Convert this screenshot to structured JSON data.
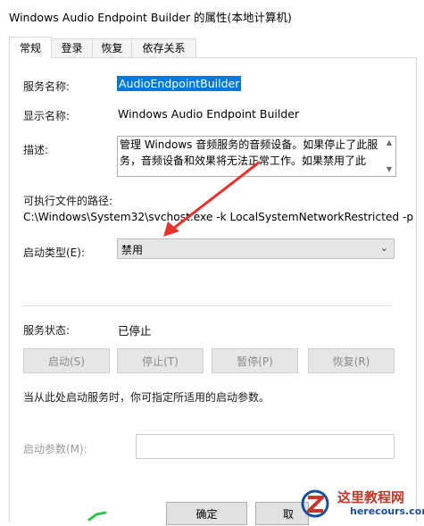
{
  "window": {
    "title": "Windows Audio Endpoint Builder 的属性(本地计算机)"
  },
  "tabs": [
    {
      "label": "常规",
      "active": true
    },
    {
      "label": "登录",
      "active": false
    },
    {
      "label": "恢复",
      "active": false
    },
    {
      "label": "依存关系",
      "active": false
    }
  ],
  "general": {
    "service_name_label": "服务名称:",
    "service_name_value": "AudioEndpointBuilder",
    "display_name_label": "显示名称:",
    "display_name_value": "Windows Audio Endpoint Builder",
    "description_label": "描述:",
    "description_value": "管理 Windows 音频服务的音频设备。如果停止了此服务，音频设备和效果将无法正常工作。如果禁用了此",
    "exe_path_label": "可执行文件的路径:",
    "exe_path_value": "C:\\Windows\\System32\\svchost.exe -k LocalSystemNetworkRestricted -p",
    "startup_type_label": "启动类型(E):",
    "startup_type_value": "禁用",
    "service_status_label": "服务状态:",
    "service_status_value": "已停止",
    "buttons": {
      "start": "启动(S)",
      "stop": "停止(T)",
      "pause": "暂停(P)",
      "resume": "恢复(R)"
    },
    "hint_text": "当从此处启动服务时，你可指定所适用的启动参数。",
    "start_params_label": "启动参数(M):",
    "start_params_value": ""
  },
  "footer": {
    "ok_label": "确定",
    "cancel_label": "取"
  },
  "watermark": {
    "site_name": "这里教程网",
    "site_domain": "herecours.com"
  },
  "colors": {
    "annotation_arrow": "#e8322e",
    "selection": "#0078d7",
    "watermark_red": "#c0392b",
    "watermark_blue": "#1a4fa0"
  }
}
